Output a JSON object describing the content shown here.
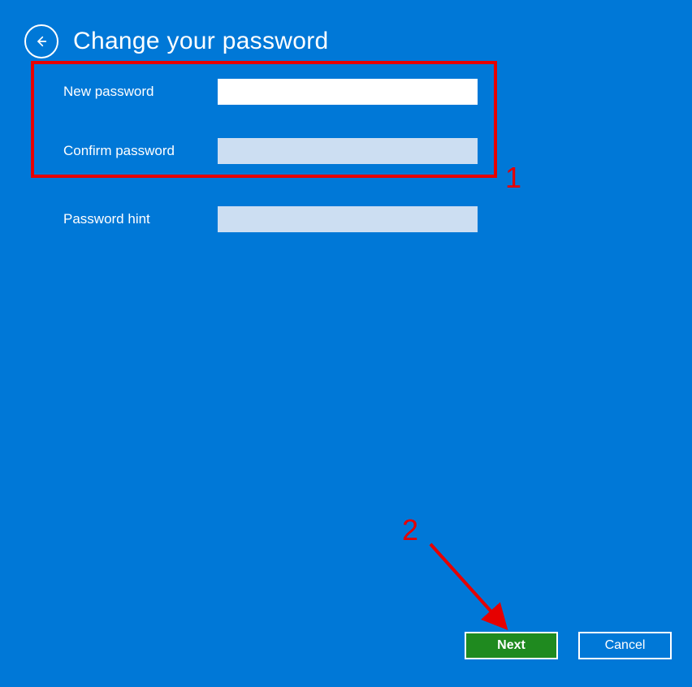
{
  "header": {
    "title": "Change your password"
  },
  "form": {
    "new_password_label": "New password",
    "new_password_value": "",
    "confirm_password_label": "Confirm password",
    "confirm_password_value": "",
    "password_hint_label": "Password hint",
    "password_hint_value": ""
  },
  "buttons": {
    "next": "Next",
    "cancel": "Cancel"
  },
  "annotations": {
    "step1": "1",
    "step2": "2"
  }
}
